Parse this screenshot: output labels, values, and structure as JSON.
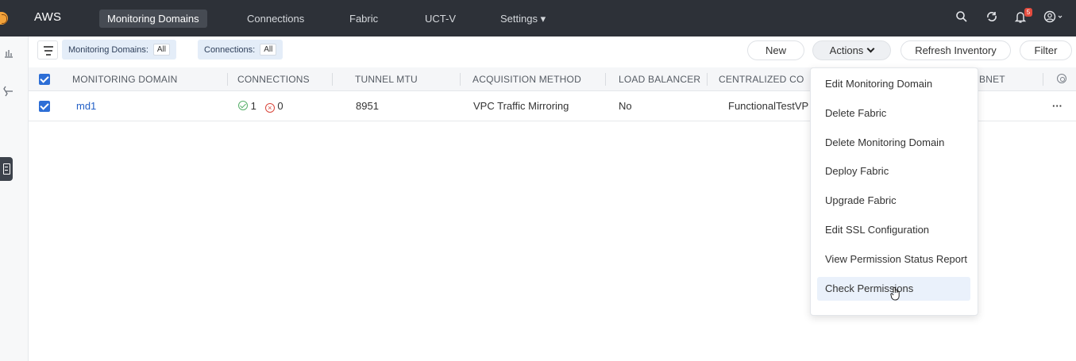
{
  "topbar": {
    "brand": "AWS",
    "nav": [
      {
        "label": "Monitoring Domains",
        "active": true
      },
      {
        "label": "Connections"
      },
      {
        "label": "Fabric"
      },
      {
        "label": "UCT-V"
      },
      {
        "label": "Settings ▾"
      }
    ],
    "icons": [
      "search-icon",
      "sync-icon",
      "bell-icon",
      "user-icon"
    ],
    "notification_count": "5"
  },
  "rail": {
    "icons": [
      "dashboard-icon",
      "topology-icon",
      "inventory-icon"
    ]
  },
  "filters": {
    "monitoring_domains_label": "Monitoring Domains:",
    "monitoring_domains_value": "All",
    "connections_label": "Connections:",
    "connections_value": "All"
  },
  "toolbar": {
    "new_label": "New",
    "actions_label": "Actions",
    "refresh_label": "Refresh Inventory",
    "filter_label": "Filter"
  },
  "table": {
    "columns": [
      "MONITORING DOMAIN",
      "CONNECTIONS",
      "TUNNEL MTU",
      "ACQUISITION METHOD",
      "LOAD BALANCER",
      "CENTRALIZED CO",
      "BNET"
    ],
    "rows": [
      {
        "domain": "md1",
        "connections_ok": "1",
        "connections_err": "0",
        "tunnel_mtu": "8951",
        "acquisition_method": "VPC Traffic Mirroring",
        "load_balancer": "No",
        "centralized": "FunctionalTestVP",
        "more": "···"
      }
    ]
  },
  "actions_menu": {
    "items": [
      "Edit Monitoring Domain",
      "Delete Fabric",
      "Delete Monitoring Domain",
      "Deploy Fabric",
      "Upgrade Fabric",
      "Edit SSL Configuration",
      "View Permission Status Report",
      "Check Permissions"
    ],
    "hovered_index": 7
  },
  "colors": {
    "topbar": "#2d3138",
    "accent": "#2d6ed6",
    "link": "#2461c7",
    "ok": "#57b06a",
    "error": "#d9463b"
  }
}
